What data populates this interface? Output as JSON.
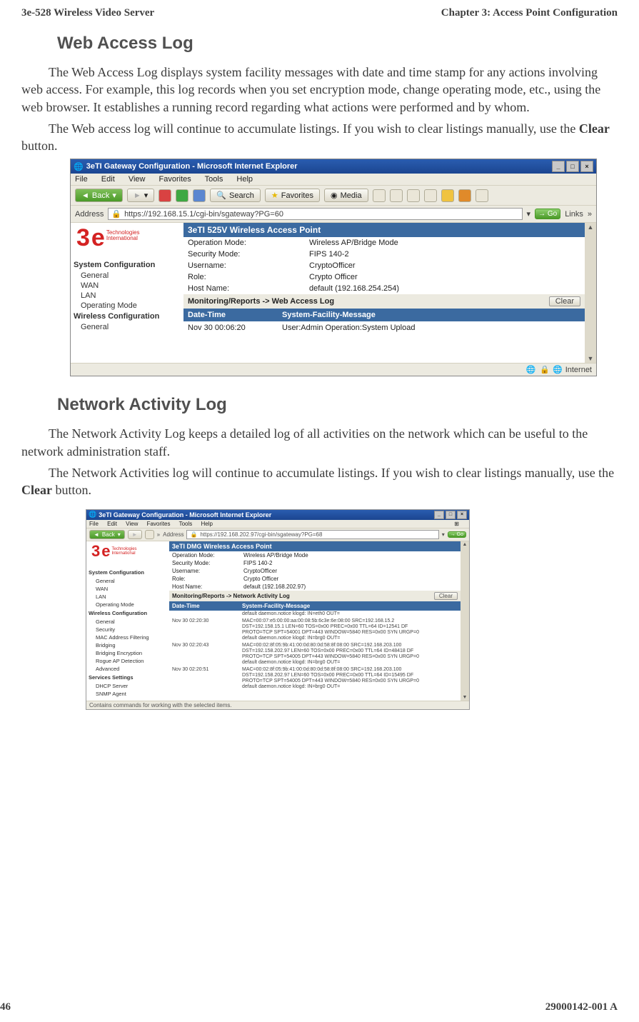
{
  "header": {
    "left": "3e-528 Wireless Video Server",
    "right": "Chapter 3: Access Point Configuration"
  },
  "section1": {
    "heading": "Web Access Log",
    "para1": "The Web Access Log displays system facility messages with date and time stamp for any actions involving web access. For example, this log records when you set encryption mode, change operating mode, etc., using the web browser. It establishes a running record regarding what actions were performed and by whom.",
    "para2_pre": "The Web access  log will continue to accumulate listings. If you wish to clear listings manually, use the ",
    "para2_bold": "Clear",
    "para2_post": " button."
  },
  "shot1": {
    "title": "3eTI Gateway Configuration - Microsoft Internet Explorer",
    "menus": [
      "File",
      "Edit",
      "View",
      "Favorites",
      "Tools",
      "Help"
    ],
    "back_label": "Back",
    "search_label": "Search",
    "favorites_label": "Favorites",
    "media_label": "Media",
    "address_label": "Address",
    "url": "https://192.168.15.1/cgi-bin/sgateway?PG=60",
    "go_label": "Go",
    "links_label": "Links",
    "logo_sub": "Technologies\nInternational",
    "nav": {
      "heading1": "System Configuration",
      "items1": [
        "General",
        "WAN",
        "LAN",
        "Operating Mode"
      ],
      "heading2": "Wireless Configuration",
      "items2": [
        "General"
      ]
    },
    "ap_title": "3eTI 525V Wireless Access Point",
    "kv": [
      {
        "k": "Operation Mode:",
        "v": "Wireless AP/Bridge Mode"
      },
      {
        "k": "Security Mode:",
        "v": "FIPS 140-2"
      },
      {
        "k": "Username:",
        "v": "CryptoOfficer"
      },
      {
        "k": "Role:",
        "v": "Crypto Officer"
      },
      {
        "k": "Host Name:",
        "v": "default (192.168.254.254)"
      }
    ],
    "sechead": "Monitoring/Reports -> Web Access Log",
    "clear_label": "Clear",
    "cols": [
      "Date-Time",
      "System-Facility-Message"
    ],
    "rows": [
      {
        "dt": "Nov 30 00:06:20",
        "msg": "User:Admin Operation:System Upload"
      }
    ],
    "status_zone": "Internet"
  },
  "section2": {
    "heading": "Network Activity Log",
    "para1": "The Network Activity Log keeps a detailed log of all activities on the network which can be useful to the network administration staff.",
    "para2_pre": "The  Network Activities  log will continue to accumulate listings. If you wish to clear listings manually, use the ",
    "para2_bold": "Clear",
    "para2_post": " button."
  },
  "shot2": {
    "title": "3eTI Gateway Configuration - Microsoft Internet Explorer",
    "menus": [
      "File",
      "Edit",
      "View",
      "Favorites",
      "Tools",
      "Help"
    ],
    "back_label": "Back",
    "address_label": "Address",
    "url": "https://192.168.202.97/cgi-bin/sgateway?PG=68",
    "go_label": "Go",
    "logo_sub": "Technologies\nInternational",
    "nav": {
      "heading1": "System Configuration",
      "items1": [
        "General",
        "WAN",
        "LAN",
        "Operating Mode"
      ],
      "heading2": "Wireless Configuration",
      "items2": [
        "General",
        "Security",
        "MAC Address Filtering",
        "Bridging",
        "Bridging Encryption",
        "Rogue AP Detection",
        "Advanced"
      ],
      "heading3": "Services Settings",
      "items3": [
        "DHCP Server",
        "SNMP Agent"
      ]
    },
    "ap_title": "3eTI DMG Wireless Access Point",
    "kv": [
      {
        "k": "Operation Mode:",
        "v": "Wireless AP/Bridge Mode"
      },
      {
        "k": "Security Mode:",
        "v": "FIPS 140-2"
      },
      {
        "k": "Username:",
        "v": "CryptoOfficer"
      },
      {
        "k": "Role:",
        "v": "Crypto Officer"
      },
      {
        "k": "Host Name:",
        "v": "default (192.168.202.97)"
      }
    ],
    "sechead": "Monitoring/Reports -> Network Activity Log",
    "clear_label": "Clear",
    "cols": [
      "Date-Time",
      "System-Facility-Message"
    ],
    "rows": [
      {
        "dt": "",
        "msg": "default daemon.notice klogd: IN=eth0 OUT="
      },
      {
        "dt": "Nov 30 02:20:30",
        "msg": "MAC=00:07:e5:00:00:aa:00:08:5b:6c3e:6e:08:00 SRC=192.168.15.2\nDST=192.158.15.1 LEN=60 TOS=0x00 PREC=0x00 TTL=64 ID=12541 DF\nPROTO=TCP SPT=54001 DPT=443 WINDOW=5840 RES=0x00 SYN URGP=0\ndefault daemon.notice klogd: IN=brg0 OUT="
      },
      {
        "dt": "Nov 30 02:20:43",
        "msg": "MAC=00:02:8f:05:9b:41:00:0d:80:0d:58:8f:08:00 SRC=192.168.203.100\nDST=192.158.202.97 LEN=60 TOS=0x00 PREC=0x00 TTL=64 ID=48418 DF\nPROTO=TCP SPT=54005 DPT=443 WINDOW=5840 RES=0x00 SYN URGP=0\ndefault daemon.notice klogd: IN=brg0 OUT="
      },
      {
        "dt": "Nov 30 02:20:51",
        "msg": "MAC=00:02:8f:05:9b:41:00:0d:80:0d:58:8f:08:00 SRC=192.168.203.100\nDST=192.158.202.97 LEN=60 TOS=0x00 PREC=0x00 TTL=64 ID=15495 DF\nPROTO=TCP SPT=54005 DPT=443 WINDOW=5840 RES=0x00 SYN URGP=0\ndefault daemon.notice klogd: IN=brg0 OUT="
      }
    ],
    "status_text": "Contains commands for working with the selected items."
  },
  "footer": {
    "left": "46",
    "right": "29000142-001 A"
  }
}
